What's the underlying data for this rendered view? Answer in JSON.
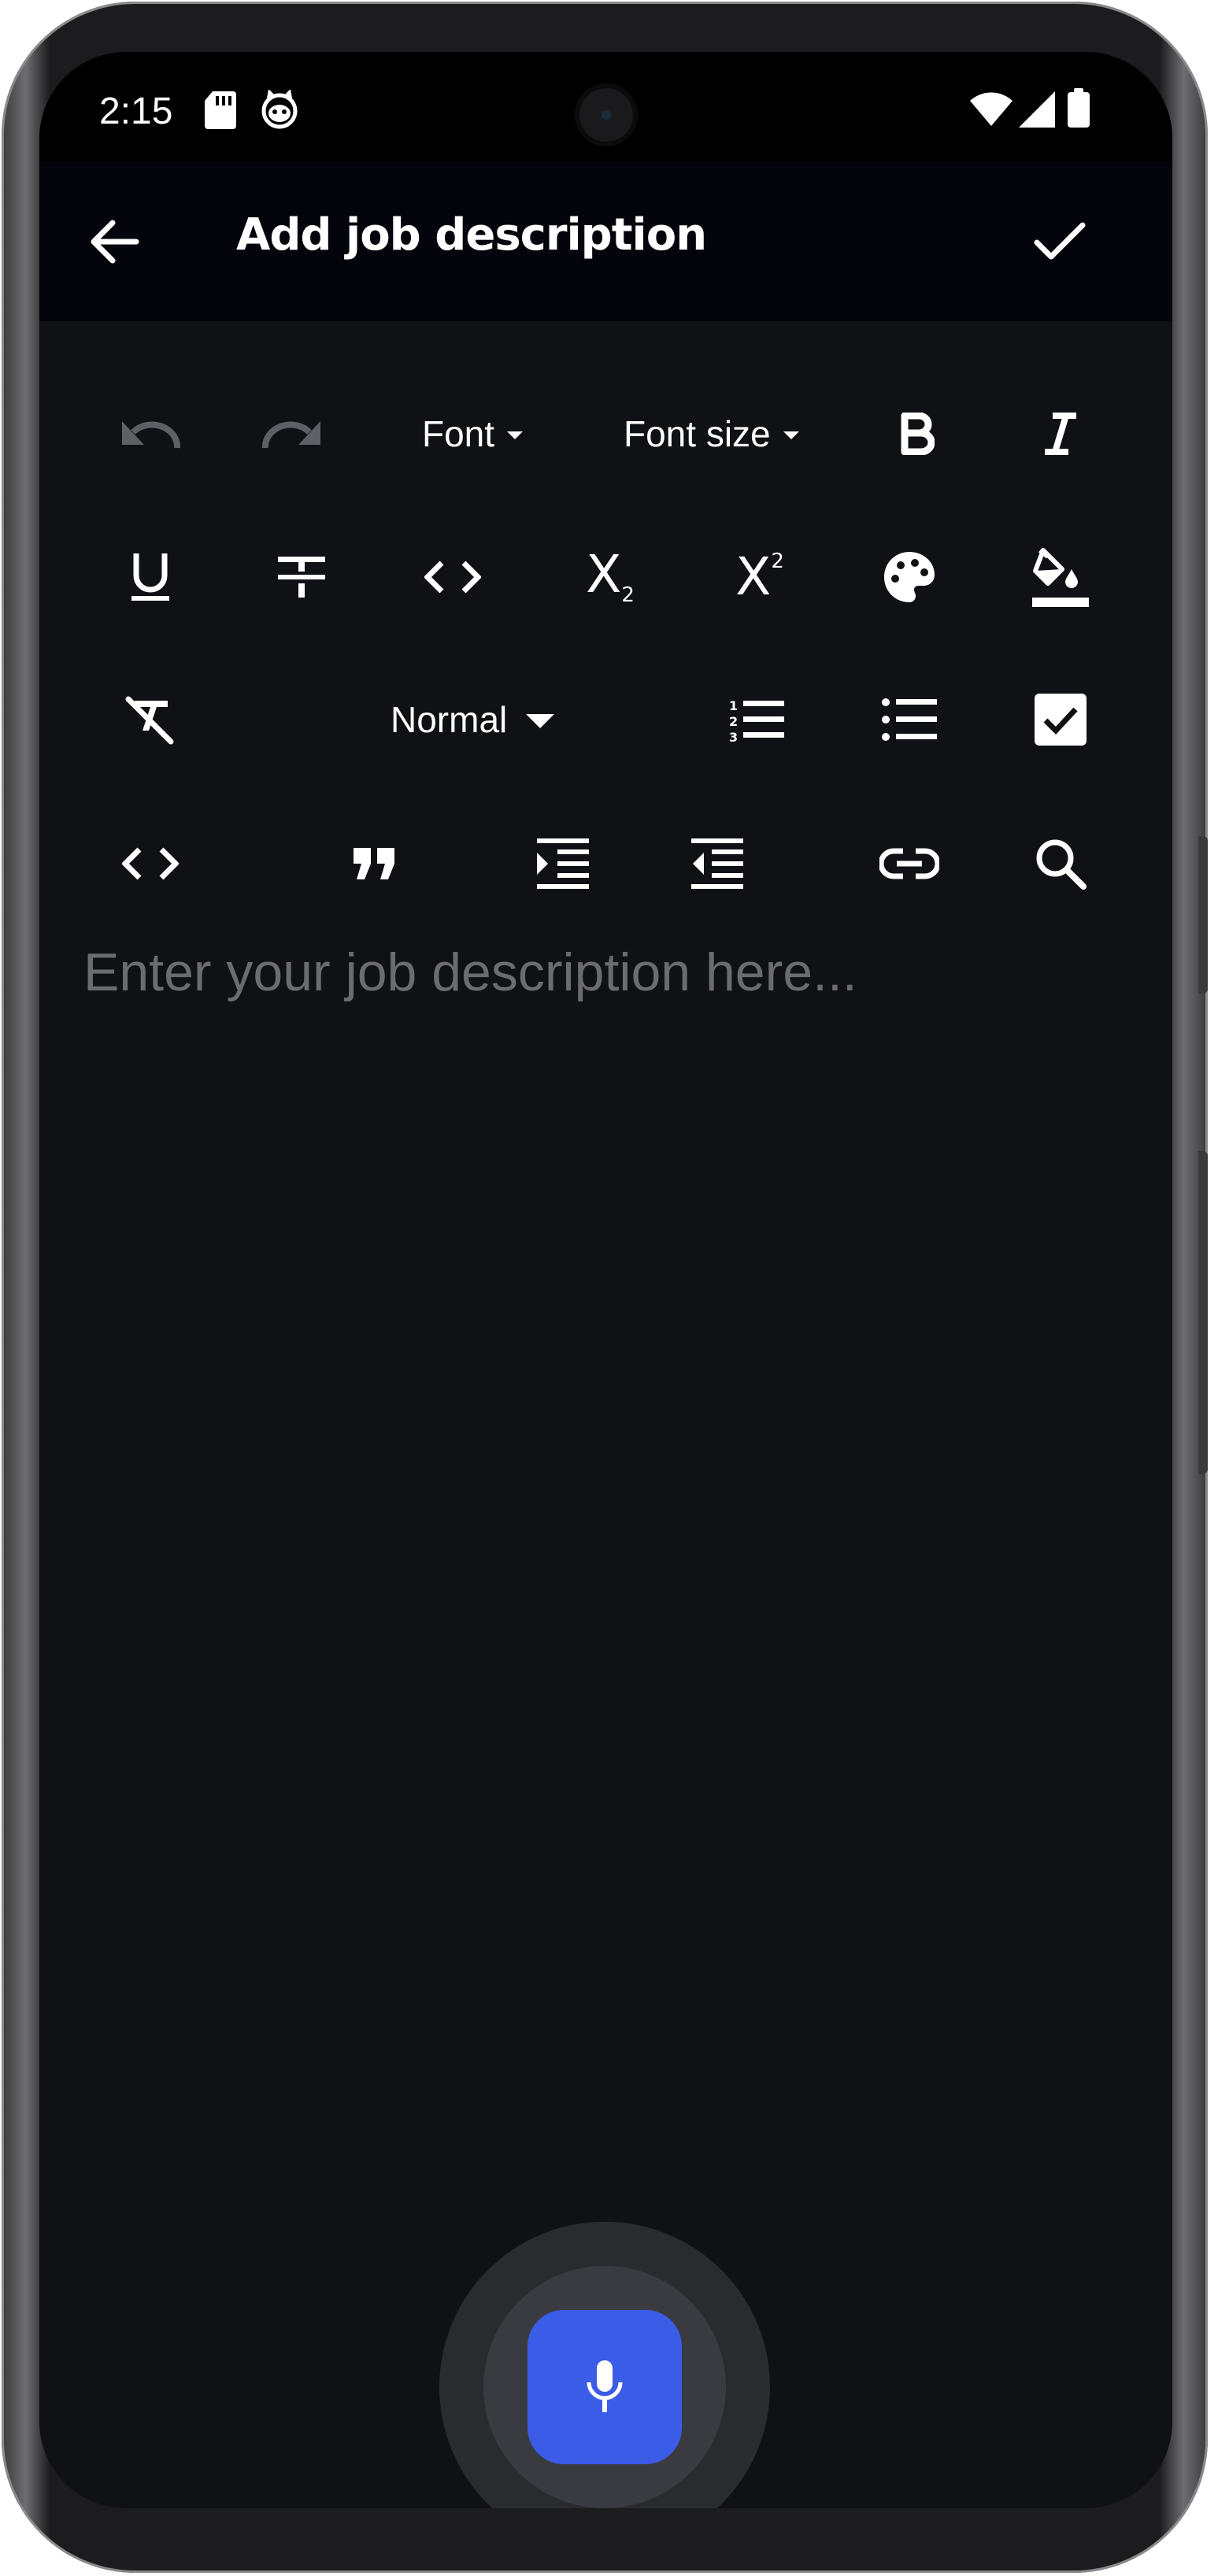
{
  "status_bar": {
    "time": "2:15",
    "icons": [
      "sd-card-icon",
      "cat-face-icon",
      "wifi-icon",
      "signal-icon",
      "battery-icon"
    ]
  },
  "app_bar": {
    "title": "Add job description",
    "back_icon": "arrow-left-icon",
    "confirm_icon": "check-icon"
  },
  "toolbar": {
    "font_label": "Font",
    "font_size_label": "Font size",
    "paragraph_style": "Normal"
  },
  "editor": {
    "placeholder": "Enter your job description here..."
  },
  "colors": {
    "background": "#101115",
    "app_bar": "#04050c",
    "accent": "#3b5ce6",
    "placeholder": "#6b6c70",
    "disabled_icon": "#5f6066"
  }
}
